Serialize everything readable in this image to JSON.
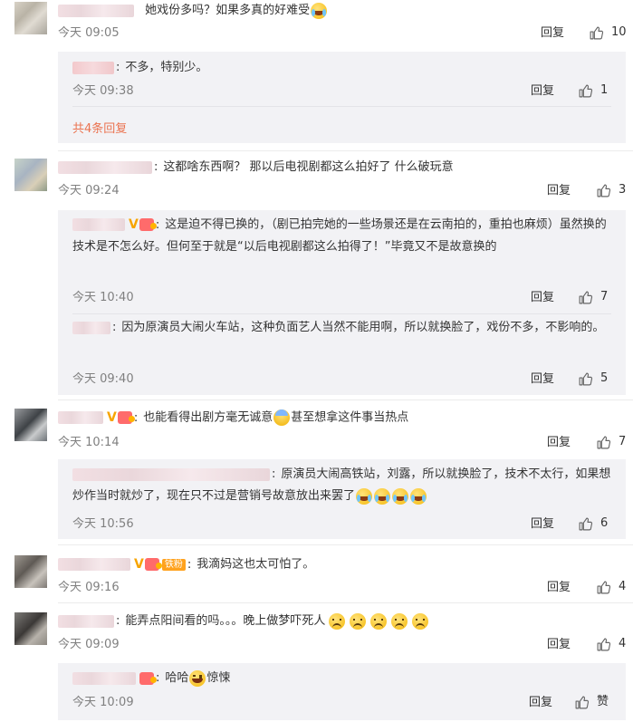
{
  "labels": {
    "reply": "回复",
    "today": "今天"
  },
  "comments": [
    {
      "text": "她戏份多吗？如果多真的好难受",
      "time": "今天 09:05",
      "likes": "10",
      "replies": [
        {
          "text": "不多，特别少。",
          "time": "今天 09:38",
          "likes": "1"
        }
      ],
      "more": "共4条回复"
    },
    {
      "text": "这都啥东西啊？ 那以后电视剧都这么拍好了  什么破玩意",
      "time": "今天 09:24",
      "likes": "3",
      "replies": [
        {
          "text": "这是迫不得已换的，（剧已拍完她的一些场景还是在云南拍的，重拍也麻烦）虽然换的技术是不怎么好。但何至于就是“以后电视剧都这么拍得了！”毕竟又不是故意换的",
          "time": "今天 10:40",
          "likes": "7"
        },
        {
          "text": "因为原演员大闹火车站，这种负面艺人当然不能用啊，所以就换脸了，戏份不多，不影响的。",
          "time": "今天 09:40",
          "likes": "5"
        }
      ]
    },
    {
      "text_a": "也能看得出剧方毫无诚意",
      "text_b": "甚至想拿这件事当热点",
      "time": "今天 10:14",
      "likes": "7",
      "replies": [
        {
          "text": "原演员大闹高铁站，刘露，所以就换脸了，技术不太行，如果想炒作当时就炒了，现在只不过是营销号故意放出来罢了",
          "time": "今天 10:56",
          "likes": "6"
        }
      ]
    },
    {
      "badge": "铁粉",
      "text": "我滴妈这也太可怕了。",
      "time": "今天 09:16",
      "likes": "4"
    },
    {
      "text": "能弄点阳间看的吗。。。晚上做梦吓死人",
      "time": "今天 09:09",
      "likes": "4",
      "replies": [
        {
          "text_a": "哈哈",
          "text_b": "惊悚",
          "time": "今天 10:09",
          "likes": "赞"
        }
      ]
    }
  ],
  "colors": {
    "accent": "#eb7350",
    "time": "#808080",
    "subbox": "#f2f2f5",
    "vip": "#f7a400"
  },
  "icons": {
    "like": "thumbs-up-icon",
    "vip": "v-verified-icon",
    "medal": "medal-icon"
  }
}
